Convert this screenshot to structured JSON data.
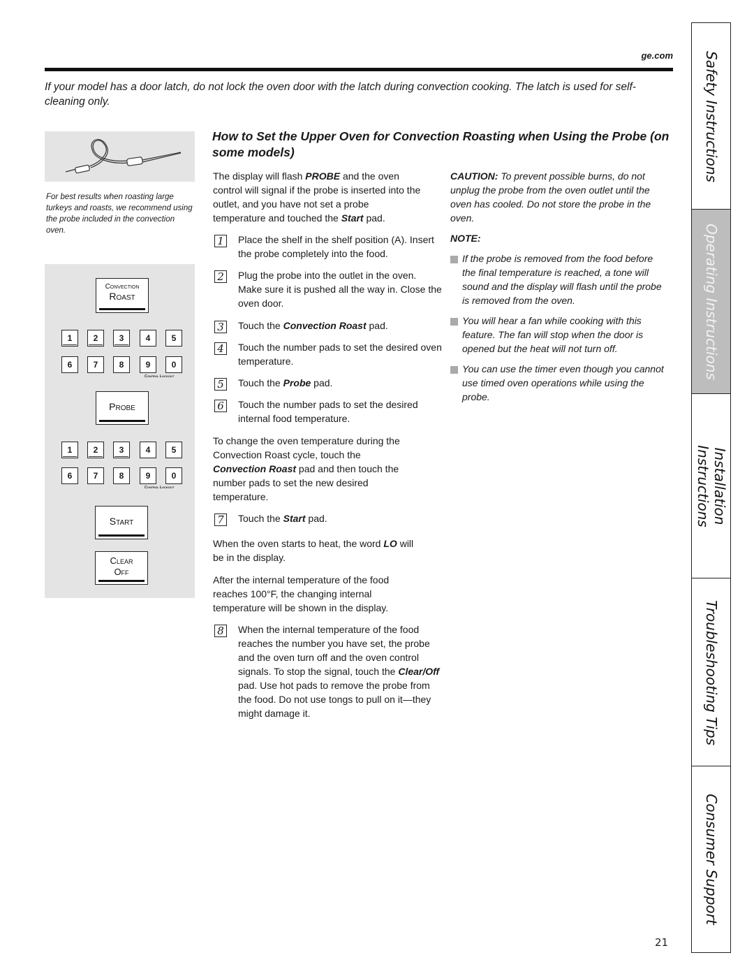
{
  "header": {
    "site": "ge.com",
    "intro": "If your model has a door latch, do not lock the oven door with the latch during convection cooking. The latch is used for self-cleaning only."
  },
  "left": {
    "probe_image_alt": "oven-probe-illustration",
    "probe_caption": "For best results when roasting large turkeys and roasts, we recommend using the probe included in the convection oven.",
    "panel": {
      "convection_roast": [
        "Convection",
        "Roast"
      ],
      "digits_row1": [
        "1",
        "2",
        "3",
        "4",
        "5"
      ],
      "digits_row2": [
        "6",
        "7",
        "8",
        "9",
        "0"
      ],
      "lockout": "Control Lockout",
      "probe": "Probe",
      "start": "Start",
      "clear_off": [
        "Clear",
        "Off"
      ]
    }
  },
  "main": {
    "heading": "How to Set the Upper Oven for Convection Roasting when Using the Probe (on some models)",
    "intro_parts": [
      "The display will flash ",
      "PROBE",
      " and the oven control will signal if the probe is inserted into the outlet, and you have not set a probe temperature and touched the ",
      "Start",
      " pad."
    ],
    "steps": [
      {
        "n": "1",
        "text": "Place the shelf in the shelf position (A). Insert the probe completely into the food."
      },
      {
        "n": "2",
        "text": "Plug the probe into the outlet in the oven. Make sure it is pushed all the way in. Close the oven door."
      },
      {
        "n": "3",
        "pre": "Touch the ",
        "em": "Convection Roast",
        "post": " pad."
      },
      {
        "n": "4",
        "text": "Touch the number pads to set the desired oven temperature."
      },
      {
        "n": "5",
        "pre": "Touch the ",
        "em": "Probe",
        "post": " pad."
      },
      {
        "n": "6",
        "text": "Touch the number pads to set the desired internal food temperature."
      },
      {
        "n": "7",
        "pre": "Touch the ",
        "em": "Start",
        "post": " pad."
      },
      {
        "n": "8",
        "pre": "When the internal temperature of the food reaches the number you have set, the probe and the oven turn off and the oven control signals. To stop the signal, touch the ",
        "em": "Clear/Off",
        "post": " pad. Use hot pads to remove the probe from the food. Do not use tongs to pull on it—they might damage it."
      }
    ],
    "change_temp": {
      "pre": "To change the oven temperature during the Convection Roast cycle, touch the ",
      "em": "Convection Roast",
      "post": " pad and then touch the number pads to set the new desired temperature."
    },
    "lo_note": {
      "em": "LO",
      "pre": "When the oven starts to heat, the word ",
      "post": " will be in the display."
    },
    "internal_note": "After the internal temperature of the food reaches 100°F, the changing internal temperature will be shown in the display."
  },
  "right": {
    "caution_label": "CAUTION:",
    "caution_text": " To prevent possible burns, do not unplug the probe from the oven outlet until the oven has cooled. Do not store the probe in the oven.",
    "note_label": "NOTE:",
    "notes": [
      "If the probe is removed from the food before the final temperature is reached, a tone will sound and the display will flash until the probe is removed from the oven.",
      "You will hear a fan while cooking with this feature. The fan will stop when the door is opened but the heat will not turn off.",
      "You can use the timer even though you cannot use timed oven operations while using the probe."
    ]
  },
  "tabs": [
    {
      "label": "Safety Instructions",
      "active": false
    },
    {
      "label": "Operating Instructions",
      "active": true
    },
    {
      "label": "Installation\nInstructions",
      "active": false
    },
    {
      "label": "Troubleshooting Tips",
      "active": false
    },
    {
      "label": "Consumer Support",
      "active": false
    }
  ],
  "page_number": "21",
  "colors": {
    "active_tab": "#bdbdbd",
    "panel_bg": "#e4e4e4",
    "bullet": "#aaaaaa"
  }
}
